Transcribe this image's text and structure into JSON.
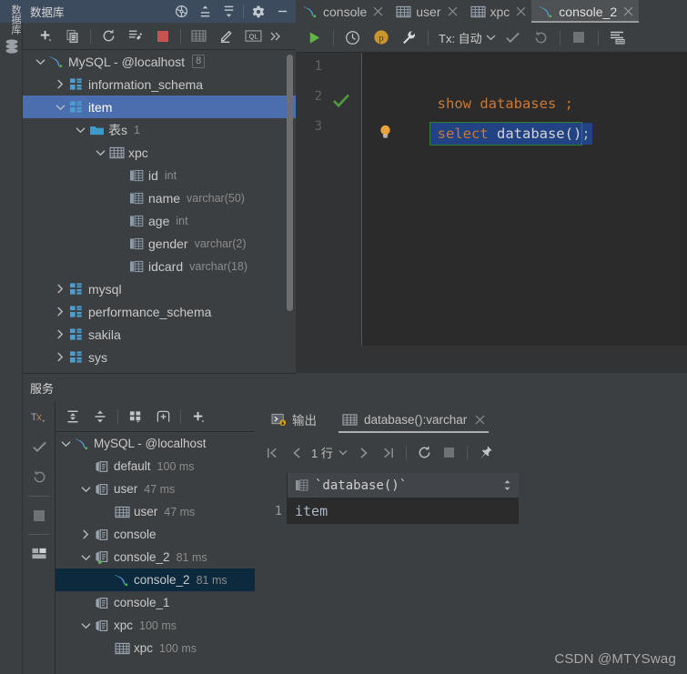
{
  "app": {
    "vertical_strip_label": "数据库",
    "db_panel_title": "数据库",
    "services_panel_title": "服务",
    "watermark": "CSDN @MTYSwag"
  },
  "db_header_icons": [
    {
      "name": "sync-settings-icon",
      "glyph": "steering"
    },
    {
      "name": "expand-all-icon",
      "glyph": "expand"
    },
    {
      "name": "collapse-all-icon",
      "glyph": "collapse"
    },
    {
      "name": "settings-gear-icon",
      "glyph": "gear"
    },
    {
      "name": "hide-panel-icon",
      "glyph": "minus"
    }
  ],
  "db_toolbar_icons": [
    {
      "name": "add-data-source-button",
      "glyph": "plus-dropdown"
    },
    {
      "name": "duplicate-button",
      "glyph": "copy"
    },
    {
      "name": "refresh-button",
      "glyph": "refresh"
    },
    {
      "name": "data-source-properties-button",
      "glyph": "wrench-stack"
    },
    {
      "name": "stop-button",
      "glyph": "stop-red"
    },
    {
      "name": "table-editor-button",
      "glyph": "table-grid"
    },
    {
      "name": "modify-button",
      "glyph": "pencil"
    },
    {
      "name": "query-console-button",
      "glyph": "ql"
    },
    {
      "name": "more-button",
      "glyph": "chevrons"
    }
  ],
  "db_tree": [
    {
      "label": "MySQL - @localhost",
      "icon": "mysql-dolphin-icon",
      "arrow": "down",
      "indent": 0,
      "badge": "8",
      "selected": false
    },
    {
      "label": "information_schema",
      "icon": "schema-icon",
      "arrow": "right",
      "indent": 1,
      "selected": false
    },
    {
      "label": "item",
      "icon": "schema-icon",
      "arrow": "down",
      "indent": 1,
      "selected": true
    },
    {
      "label": "表s",
      "icon": "folder-icon",
      "arrow": "down",
      "indent": 2,
      "count": "1",
      "selected": false
    },
    {
      "label": "xpc",
      "icon": "table-icon",
      "arrow": "down",
      "indent": 3,
      "selected": false
    },
    {
      "label": "id",
      "icon": "column-icon",
      "arrow": "none",
      "indent": 4,
      "type": "int",
      "selected": false
    },
    {
      "label": "name",
      "icon": "column-icon",
      "arrow": "none",
      "indent": 4,
      "type": "varchar(50)",
      "selected": false
    },
    {
      "label": "age",
      "icon": "column-icon",
      "arrow": "none",
      "indent": 4,
      "type": "int",
      "selected": false
    },
    {
      "label": "gender",
      "icon": "column-icon",
      "arrow": "none",
      "indent": 4,
      "type": "varchar(2)",
      "selected": false
    },
    {
      "label": "idcard",
      "icon": "column-icon",
      "arrow": "none",
      "indent": 4,
      "type": "varchar(18)",
      "selected": false
    },
    {
      "label": "mysql",
      "icon": "schema-icon",
      "arrow": "right",
      "indent": 1,
      "selected": false
    },
    {
      "label": "performance_schema",
      "icon": "schema-icon",
      "arrow": "right",
      "indent": 1,
      "selected": false
    },
    {
      "label": "sakila",
      "icon": "schema-icon",
      "arrow": "right",
      "indent": 1,
      "selected": false
    },
    {
      "label": "sys",
      "icon": "schema-icon",
      "arrow": "right",
      "indent": 1,
      "selected": false
    }
  ],
  "editor_tabs": [
    {
      "label": "console",
      "icon": "mysql-dolphin-icon",
      "active": false,
      "closable": true
    },
    {
      "label": "user",
      "icon": "table-icon",
      "active": false,
      "closable": true
    },
    {
      "label": "xpc",
      "icon": "table-icon",
      "active": false,
      "closable": true
    },
    {
      "label": "console_2",
      "icon": "mysql-dolphin-icon",
      "active": true,
      "closable": true
    }
  ],
  "editor_toolbar": {
    "run_button": "run-icon",
    "history_button": "history-icon",
    "profile_button": "profile-icon",
    "settings_button": "wrench-icon",
    "tx_label": "Tx: 自动",
    "commit_button": "commit-check-icon",
    "rollback_button": "rollback-icon",
    "stop_button": "stop-icon",
    "format_button": "format-icon"
  },
  "editor": {
    "lines": [
      {
        "num": "1",
        "text": "show databases ;",
        "has_check": false,
        "selected": false
      },
      {
        "num": "2",
        "text": "select database();",
        "has_check": true,
        "selected": true
      },
      {
        "num": "3",
        "text": "",
        "has_check": false,
        "selected": false
      }
    ],
    "line1_keyword": "show",
    "line1_rest": " databases ;",
    "line2_keyword": "select",
    "line2_fn": " database()",
    "line2_semi": ";"
  },
  "services_toolbar_vertical": [
    {
      "name": "tx-mode-button",
      "glyph": "tx"
    },
    {
      "name": "commit-button",
      "glyph": "check"
    },
    {
      "name": "rollback-button",
      "glyph": "rollback"
    },
    {
      "name": "stop-button",
      "glyph": "stop"
    },
    {
      "name": "layout-button",
      "glyph": "layout"
    }
  ],
  "services_toolbar_horizontal": [
    {
      "name": "expand-all-button",
      "glyph": "expand"
    },
    {
      "name": "collapse-all-button",
      "glyph": "collapse"
    },
    {
      "name": "group-by-button",
      "glyph": "group"
    },
    {
      "name": "new-tab-button",
      "glyph": "newtab"
    },
    {
      "name": "add-button",
      "glyph": "plus"
    }
  ],
  "services_tree": [
    {
      "label": "MySQL - @localhost",
      "icon": "mysql-dolphin-icon",
      "arrow": "down",
      "indent": 0,
      "time": "",
      "selected": false
    },
    {
      "label": "default",
      "icon": "session-icon",
      "arrow": "none",
      "indent": 1,
      "time": "100 ms",
      "selected": false
    },
    {
      "label": "user",
      "icon": "session-icon",
      "arrow": "down",
      "indent": 1,
      "time": "47 ms",
      "selected": false
    },
    {
      "label": "user",
      "icon": "table-icon",
      "arrow": "none",
      "indent": 2,
      "time": "47 ms",
      "selected": false
    },
    {
      "label": "console",
      "icon": "session-icon",
      "arrow": "right",
      "indent": 1,
      "time": "",
      "selected": false
    },
    {
      "label": "console_2",
      "icon": "session-icon-green",
      "arrow": "down",
      "indent": 1,
      "time": "81 ms",
      "selected": false
    },
    {
      "label": "console_2",
      "icon": "mysql-dolphin-icon",
      "arrow": "none",
      "indent": 2,
      "time": "81 ms",
      "selected": true
    },
    {
      "label": "console_1",
      "icon": "session-icon",
      "arrow": "none",
      "indent": 1,
      "time": "",
      "selected": false
    },
    {
      "label": "xpc",
      "icon": "session-icon",
      "arrow": "down",
      "indent": 1,
      "time": "100 ms",
      "selected": false
    },
    {
      "label": "xpc",
      "icon": "table-icon",
      "arrow": "none",
      "indent": 2,
      "time": "100 ms",
      "selected": false
    }
  ],
  "result_tabs": [
    {
      "label": "输出",
      "icon": "output-icon",
      "active": false,
      "closable": false
    },
    {
      "label": "database():varchar",
      "icon": "table-icon",
      "active": true,
      "closable": true
    }
  ],
  "result_nav": {
    "first_page": "first-page-icon",
    "prev_page": "prev-page-icon",
    "rows_label": "1 行",
    "next_page": "next-page-icon",
    "last_page": "last-page-icon",
    "reload": "reload-icon",
    "stop": "stop-icon",
    "pin": "pin-icon"
  },
  "result_grid": {
    "columns": [
      "`database()`"
    ],
    "rows": [
      {
        "num": "1",
        "cells": [
          "item"
        ]
      }
    ]
  },
  "colors": {
    "panel_bg": "#3c3f41",
    "header_bg": "#3c4b5e",
    "editor_bg": "#2b2b2b",
    "selection_blue": "#4b6eaf",
    "selection_dark": "#0d293e",
    "accent_cyan": "#4d9ece",
    "keyword_orange": "#cc7832",
    "code_text": "#a9b7c6",
    "run_green": "#62b543",
    "stop_red": "#c75450",
    "profile_orange": "#d4a017"
  }
}
